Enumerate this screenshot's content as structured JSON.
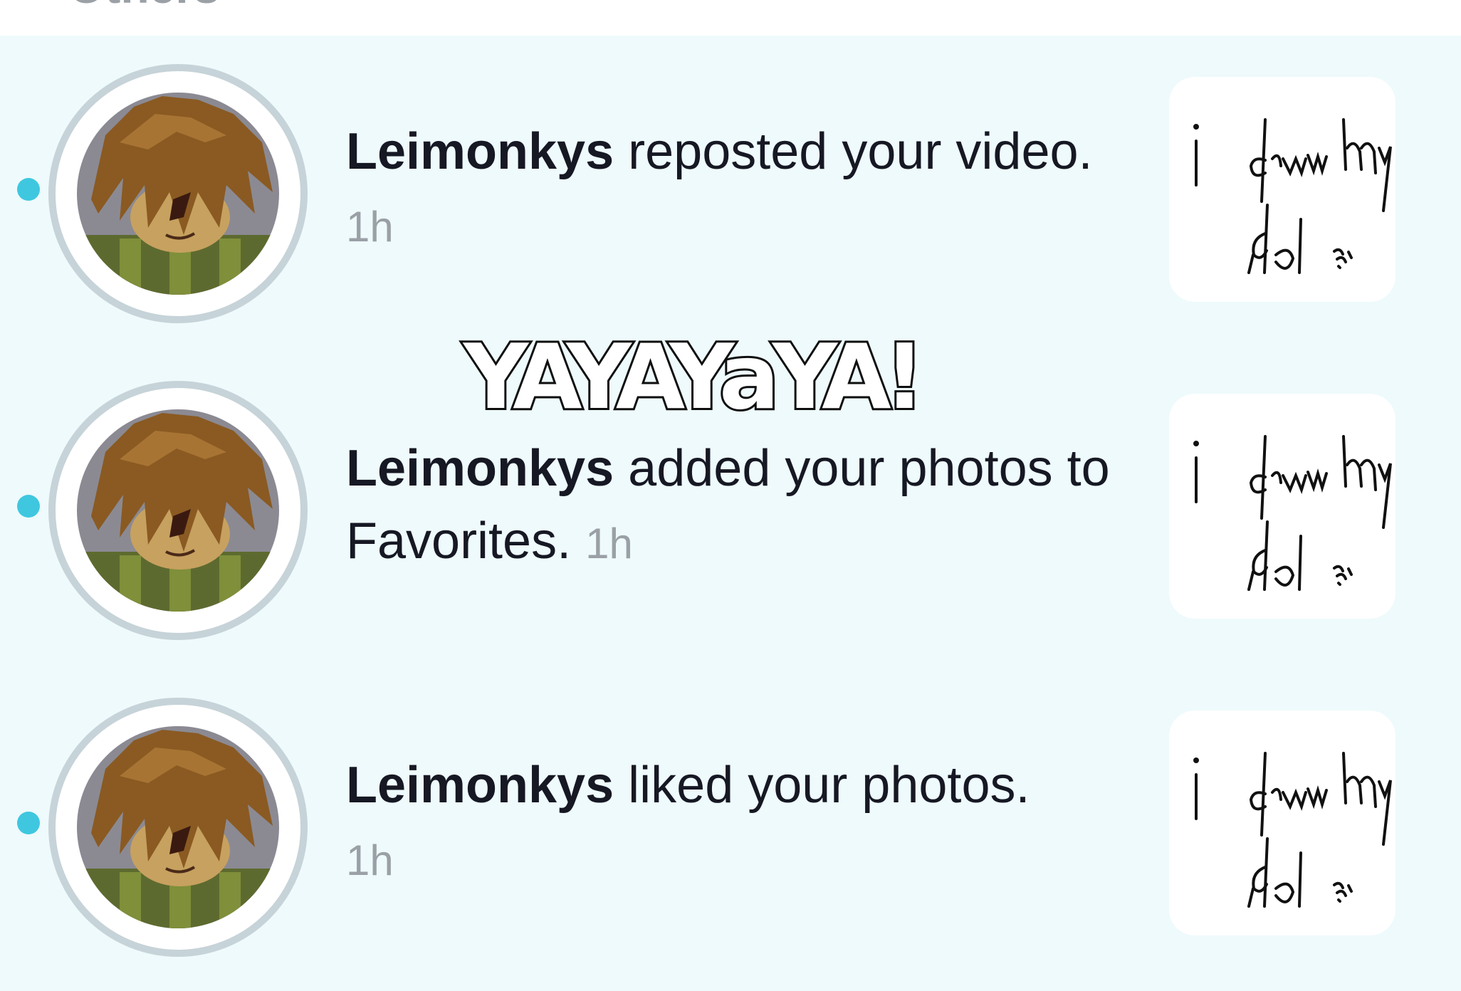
{
  "section": {
    "title": "Others"
  },
  "overlay": {
    "caption": "YAYAYaYA!"
  },
  "colors": {
    "background": "#eefafc",
    "unread_dot": "#3fc7e0",
    "avatar_ring": "#c6d3d8",
    "timestamp": "#9aa0a6"
  },
  "notifications": [
    {
      "actor": "Leimonkys",
      "action": "reposted your video.",
      "time": "1h",
      "unread": true,
      "thumbnail_text": "i draw my idol"
    },
    {
      "actor": "Leimonkys",
      "action": "added your photos to Favorites.",
      "time": "1h",
      "unread": true,
      "thumbnail_text": "i draw my idol"
    },
    {
      "actor": "Leimonkys",
      "action": "liked your photos.",
      "time": "1h",
      "unread": true,
      "thumbnail_text": "i draw my idol"
    }
  ]
}
